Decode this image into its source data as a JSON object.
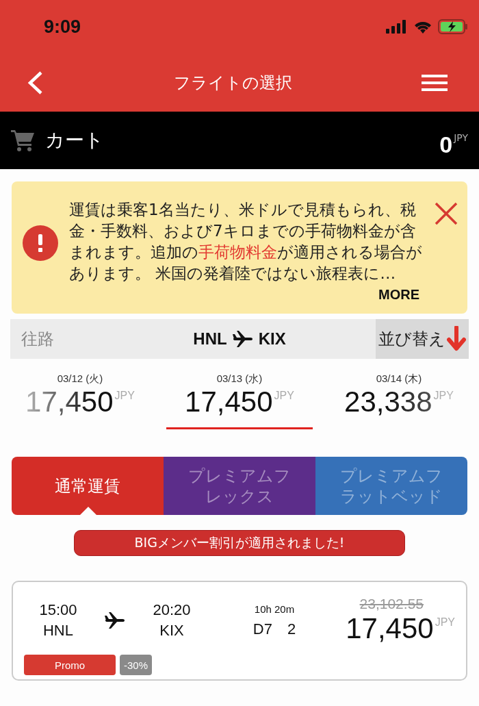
{
  "status_bar": {
    "time": "9:09"
  },
  "header": {
    "title": "フライトの選択"
  },
  "cart": {
    "label": "カート",
    "amount": "0",
    "currency": "JPY"
  },
  "notice": {
    "text_before": "運賃は乗客1名当たり、米ドルで見積もられ、税金・手数料、および7キロまでの手荷物料金が含まれます。追加の",
    "link": "手荷物料金",
    "text_after": "が適用される場合があります。 米国の発着陸ではない旅程表に…",
    "more": "MORE"
  },
  "route": {
    "direction": "往路",
    "origin": "HNL",
    "destination": "KIX",
    "sort": "並び替え"
  },
  "dates": [
    {
      "date": "03/12 (火)",
      "price": "17,450",
      "currency": "JPY",
      "selected": false
    },
    {
      "date": "03/13 (水)",
      "price": "17,450",
      "currency": "JPY",
      "selected": true
    },
    {
      "date": "03/14 (木)",
      "price": "23,338",
      "currency": "JPY",
      "selected": false
    }
  ],
  "fare_tabs": [
    {
      "label": "通常運賃",
      "color": "#d42d27",
      "selected": true
    },
    {
      "label": "プレミアムフレックス",
      "color": "#5c2d8a",
      "selected": false
    },
    {
      "label": "プレミアムフラットベッド",
      "color": "#3671b8",
      "selected": false
    }
  ],
  "banner": "BIGメンバー割引が適用されました!",
  "flights": [
    {
      "depart_time": "15:00",
      "depart_code": "HNL",
      "arrive_time": "20:20",
      "arrive_code": "KIX",
      "duration": "10h 20m",
      "flight_code": "D7",
      "flight_number": "2",
      "old_price": "23,102.55",
      "price": "17,450",
      "currency": "JPY",
      "tag": "Promo",
      "discount": "-30%"
    }
  ]
}
